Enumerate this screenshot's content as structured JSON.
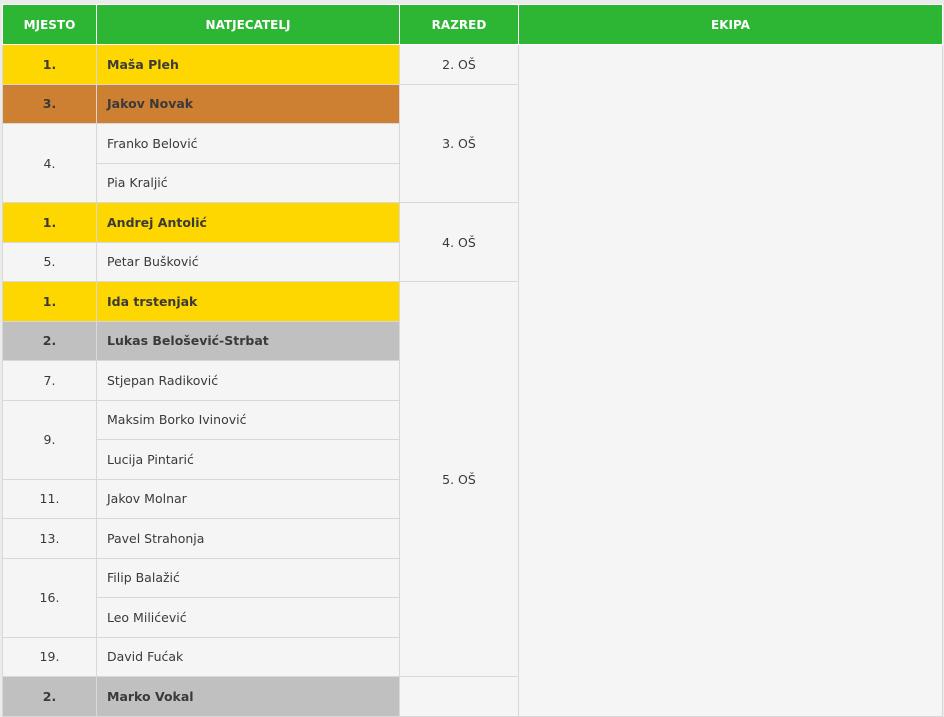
{
  "headers": {
    "mjesto": "MJESTO",
    "natjecatelj": "NATJECATELJ",
    "razred": "RAZRED",
    "ekipa": "EKIPA"
  },
  "colors": {
    "header": "#2db634",
    "gold": "#ffd700",
    "bronze": "#cd7f32",
    "silver": "#c0c0c0"
  },
  "groups": [
    {
      "razred": "2. OŠ",
      "rows": [
        {
          "mjesto": "1.",
          "name": "Maša Pleh",
          "medal": "gold"
        }
      ]
    },
    {
      "razred": "3. OŠ",
      "rows": [
        {
          "mjesto": "3.",
          "name": "Jakov Novak",
          "medal": "bronze"
        },
        {
          "mjesto": "4.",
          "name": "Franko Belović",
          "medal": "none",
          "span": 2
        },
        {
          "mjesto": null,
          "name": "Pia Kraljić",
          "medal": "none"
        }
      ]
    },
    {
      "razred": "4. OŠ",
      "rows": [
        {
          "mjesto": "1.",
          "name": "Andrej Antolić",
          "medal": "gold"
        },
        {
          "mjesto": "5.",
          "name": "Petar Bušković",
          "medal": "none"
        }
      ]
    },
    {
      "razred": "5. OŠ",
      "rows": [
        {
          "mjesto": "1.",
          "name": "Ida trstenjak",
          "medal": "gold"
        },
        {
          "mjesto": "2.",
          "name": "Lukas Belošević-Strbat",
          "medal": "silver"
        },
        {
          "mjesto": "7.",
          "name": "Stjepan Radiković",
          "medal": "none"
        },
        {
          "mjesto": "9.",
          "name": "Maksim Borko Ivinović",
          "medal": "none",
          "span": 2
        },
        {
          "mjesto": null,
          "name": "Lucija Pintarić",
          "medal": "none"
        },
        {
          "mjesto": "11.",
          "name": "Jakov Molnar",
          "medal": "none"
        },
        {
          "mjesto": "13.",
          "name": "Pavel Strahonja",
          "medal": "none"
        },
        {
          "mjesto": "16.",
          "name": "Filip Balažić",
          "medal": "none",
          "span": 2
        },
        {
          "mjesto": null,
          "name": "Leo Milićević",
          "medal": "none"
        },
        {
          "mjesto": "19.",
          "name": "David Fućak",
          "medal": "none"
        }
      ]
    },
    {
      "razred": "",
      "rows": [
        {
          "mjesto": "2.",
          "name": "Marko Vokal",
          "medal": "silver"
        }
      ]
    }
  ],
  "ekipa": ""
}
